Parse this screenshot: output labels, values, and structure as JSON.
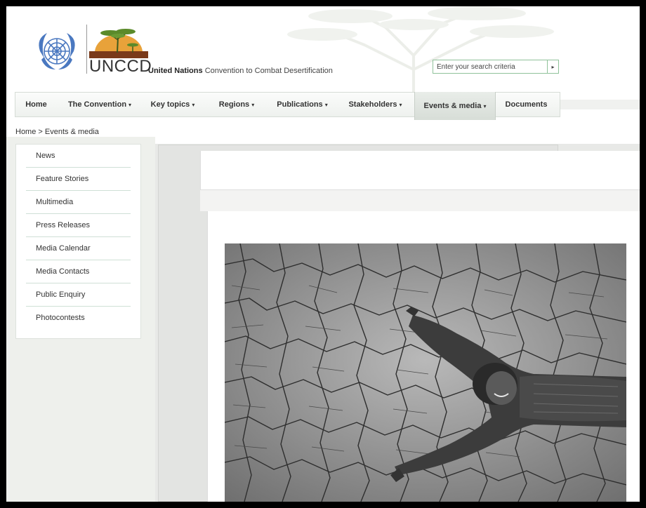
{
  "header": {
    "logo_text": "UNCCD",
    "tagline_bold": "United Nations",
    "tagline_rest": "Convention to Combat Desertification"
  },
  "search": {
    "placeholder": "Enter your search criteria",
    "button_glyph": "▸"
  },
  "nav": {
    "items": [
      {
        "label": "Home",
        "caret": ""
      },
      {
        "label": "The Convention",
        "caret": "▾"
      },
      {
        "label": "Key topics",
        "caret": "▾"
      },
      {
        "label": "Regions",
        "caret": "▾"
      },
      {
        "label": "Publications",
        "caret": "▾"
      },
      {
        "label": "Stakeholders",
        "caret": "▾"
      },
      {
        "label": "Events & media",
        "caret": "▾"
      },
      {
        "label": "Documents",
        "caret": ""
      }
    ],
    "active_index": 6
  },
  "breadcrumb": "Home > Events & media",
  "sidebar": {
    "items": [
      {
        "label": "News"
      },
      {
        "label": "Feature Stories"
      },
      {
        "label": "Multimedia"
      },
      {
        "label": "Press Releases"
      },
      {
        "label": "Media Calendar"
      },
      {
        "label": "Media Contacts"
      },
      {
        "label": "Public Enquiry"
      },
      {
        "label": "Photocontests"
      }
    ]
  },
  "colors": {
    "accent": "#8fc29a",
    "nav_active": "#d7ddd7",
    "un_blue": "#4a78c0",
    "logo_orange": "#e8a23a",
    "logo_brown": "#7a3a1a"
  },
  "icons": {
    "emblem": "un-emblem-icon",
    "logo": "unccd-tree-logo-icon",
    "search_submit": "arrow-right-icon"
  }
}
